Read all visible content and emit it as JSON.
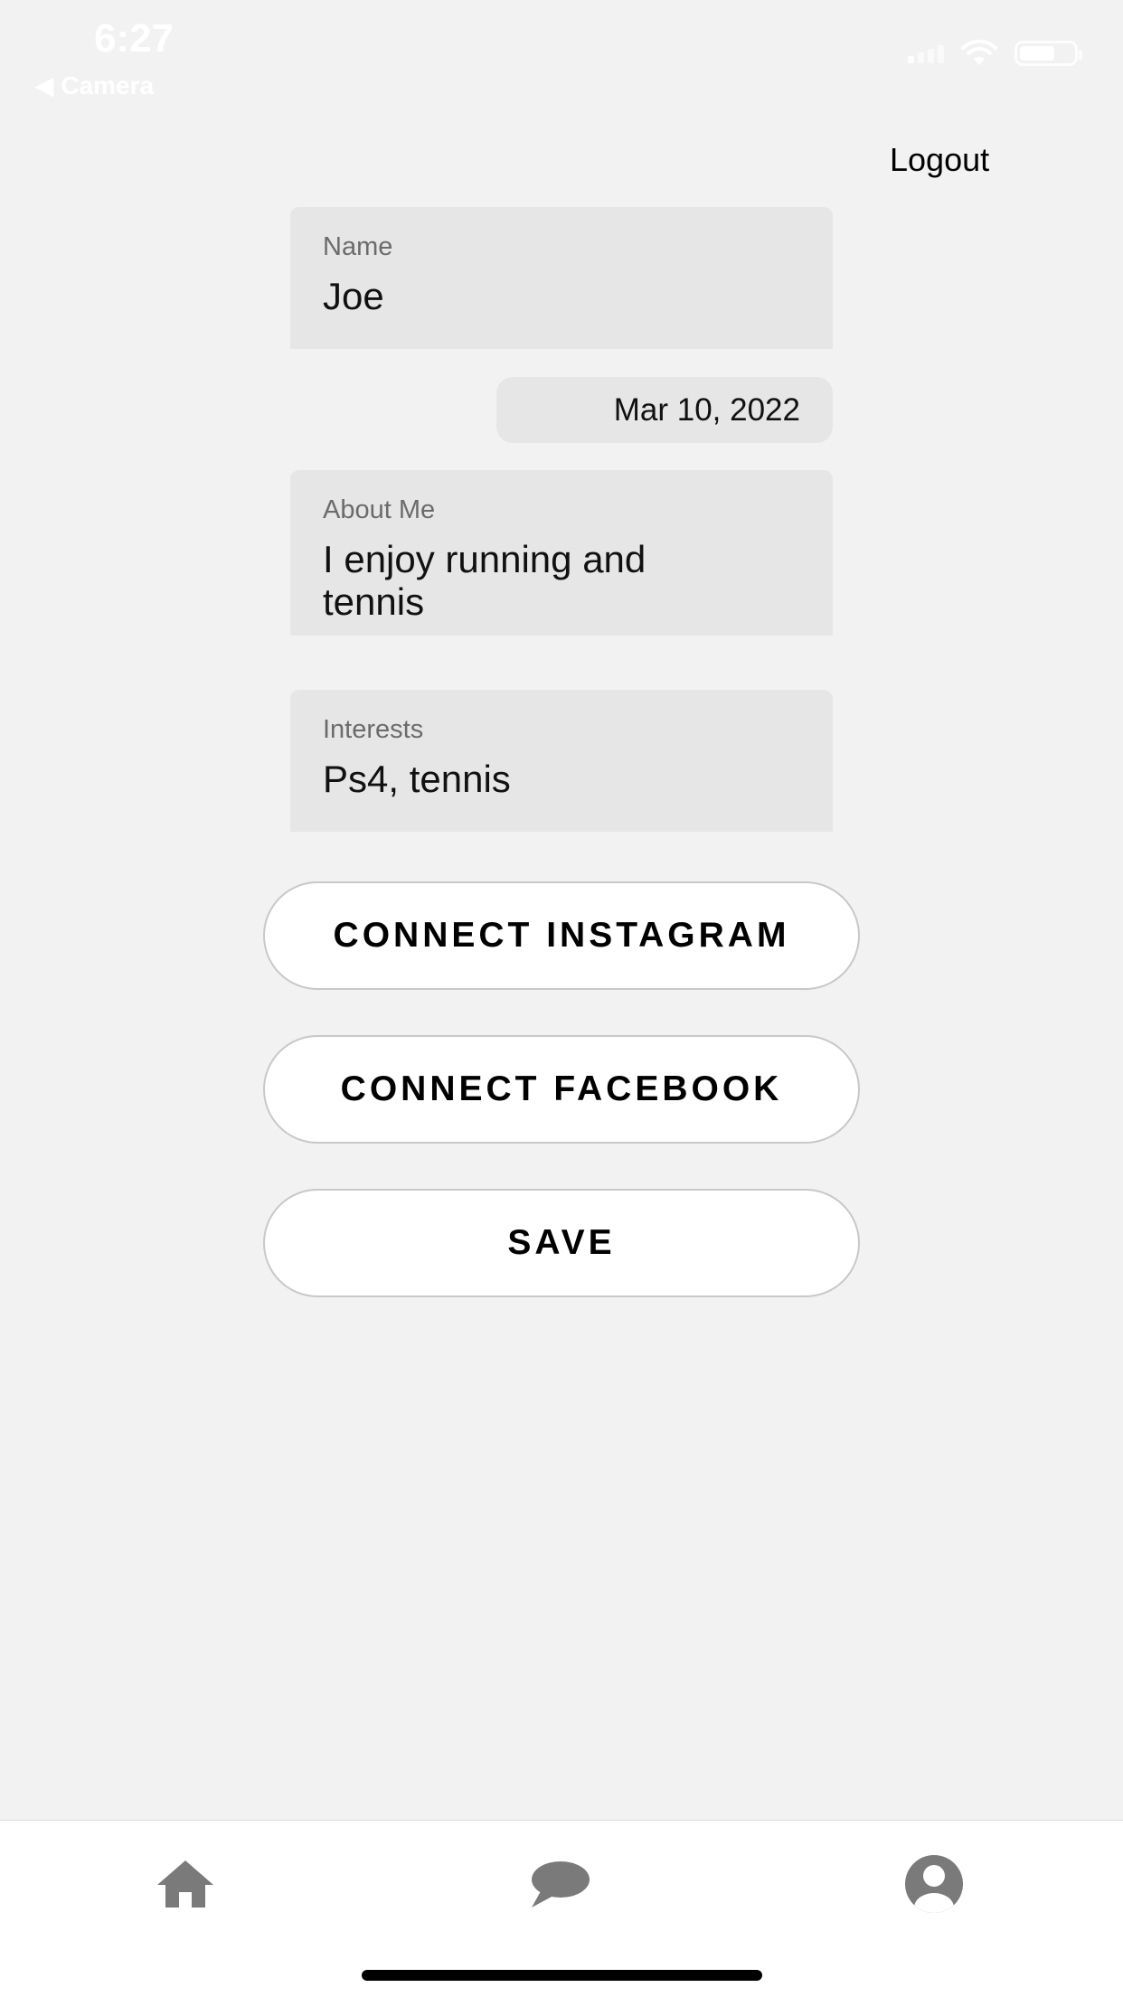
{
  "status_bar": {
    "time": "6:27",
    "back_label": "◀ Camera"
  },
  "header": {
    "logout_label": "Logout"
  },
  "form": {
    "name": {
      "label": "Name",
      "value": "Joe"
    },
    "date": {
      "value": "Mar 10, 2022"
    },
    "about": {
      "label": "About Me",
      "value": "I enjoy running and tennis"
    },
    "interests": {
      "label": "Interests",
      "value": "Ps4, tennis"
    }
  },
  "buttons": {
    "connect_instagram": "CONNECT INSTAGRAM",
    "connect_facebook": "CONNECT FACEBOOK",
    "save": "SAVE"
  },
  "tab_bar": {
    "items": [
      {
        "icon": "home-icon"
      },
      {
        "icon": "chat-icon"
      },
      {
        "icon": "profile-icon"
      }
    ]
  },
  "colors": {
    "background": "#f2f2f2",
    "field_background": "#e6e6e6",
    "icon_gray": "#7a7a7a"
  }
}
